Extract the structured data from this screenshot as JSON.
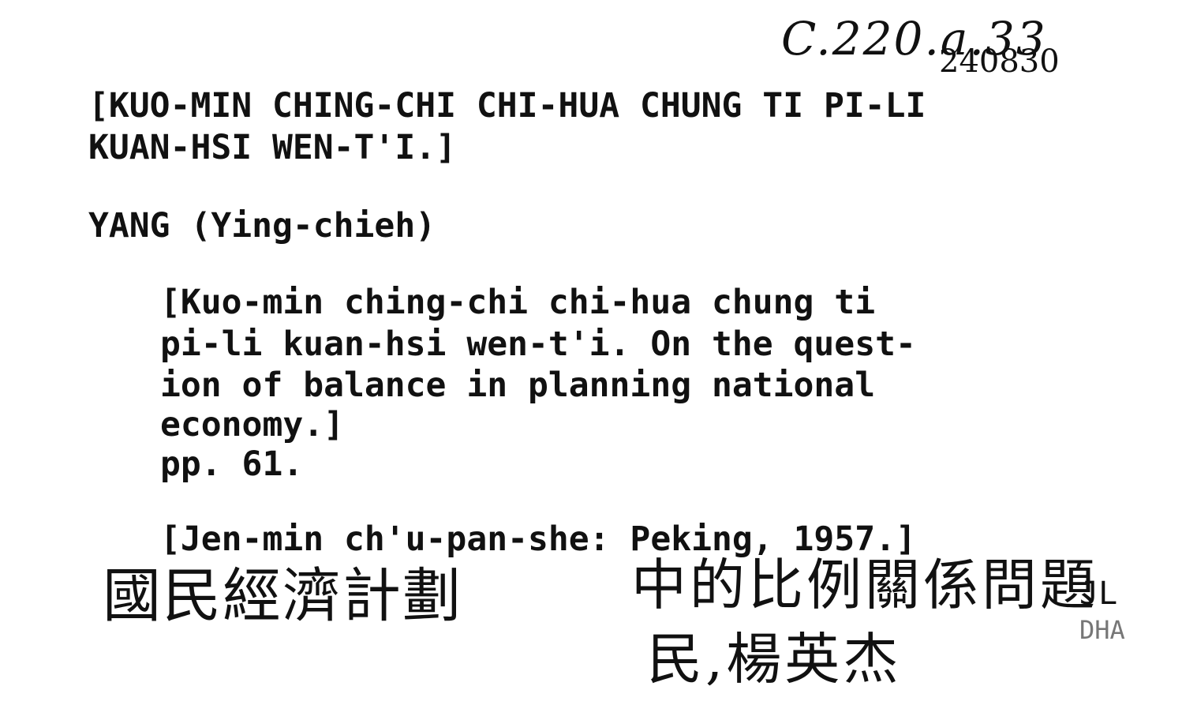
{
  "catalog_card": {
    "shelfmark": "C.220.a.33",
    "accession_number": "240830",
    "heading_line1": "[KUO-MIN CHING-CHI CHI-HUA CHUNG TI PI-LI",
    "heading_line2": "KUAN-HSI WEN-T'I.]",
    "author": "YANG (Ying-chieh)",
    "title_line1": "[Kuo-min ching-chi chi-hua chung ti",
    "title_line2": "pi-li kuan-hsi wen-t'i. On the quest-",
    "title_line3": "ion of balance in planning national",
    "title_line4": "economy.]",
    "pagination": "pp. 61.",
    "imprint": "[Jen-min ch'u-pan-she: Peking, 1957.]",
    "handwritten_chinese_1": "國民經濟計劃",
    "handwritten_chinese_2": "中的比例關係問題",
    "handwritten_chinese_3": "民,楊英杰",
    "cataloguer_initials": "JL",
    "cataloguer_initials_2": "DHA"
  }
}
